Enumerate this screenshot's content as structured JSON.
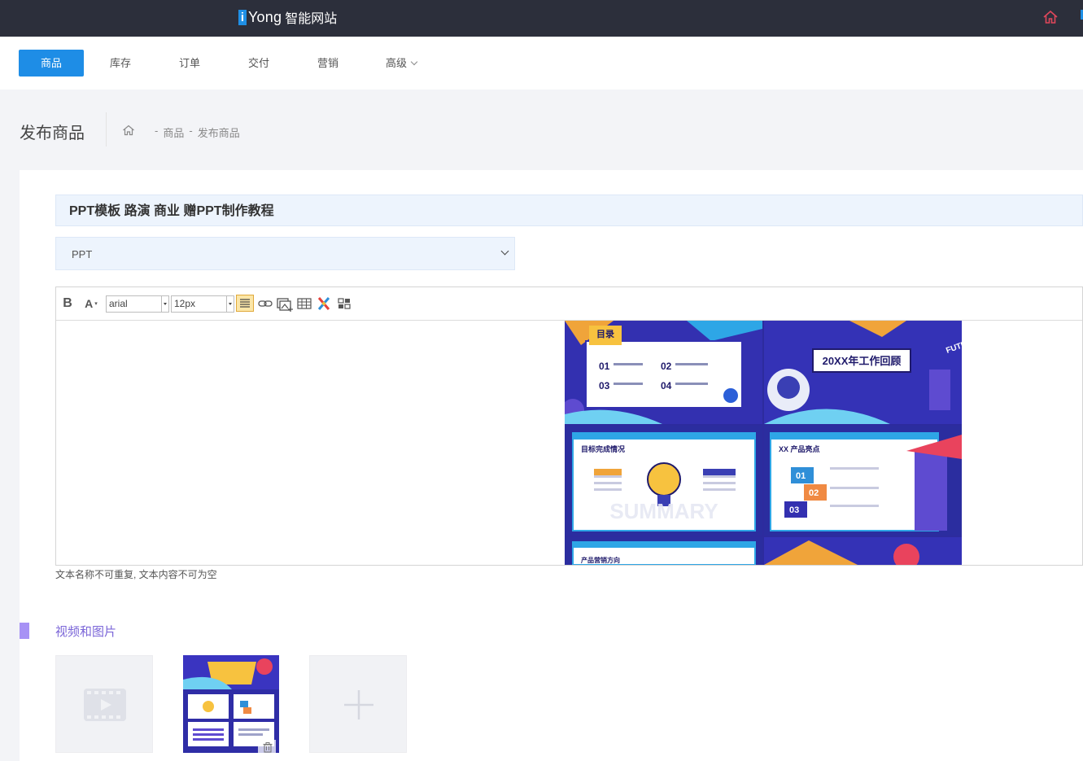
{
  "topbar": {
    "logo_mark": "i",
    "logo_brand": "Yong",
    "logo_sub": "智能网站"
  },
  "nav": {
    "items": [
      {
        "label": "商品"
      },
      {
        "label": "库存"
      },
      {
        "label": "订单"
      },
      {
        "label": "交付"
      },
      {
        "label": "营销"
      },
      {
        "label": "高级"
      }
    ]
  },
  "header": {
    "title": "发布商品",
    "breadcrumb": [
      "-",
      "商品",
      "-",
      "发布商品"
    ]
  },
  "form": {
    "product_title": "PPT模板 路演 商业 赠PPT制作教程",
    "category_value": "PPT",
    "editor": {
      "font_family": "arial",
      "font_size": "12px"
    },
    "hint": "文本名称不可重复, 文本内容不可为空"
  },
  "media": {
    "section_title": "视频和图片"
  },
  "slide": {
    "s1_title": "目录",
    "s1_items": [
      "01",
      "02",
      "03",
      "04"
    ],
    "s2_title": "20XX年工作回顾",
    "s3_title": "目标完成情况",
    "s4_title": "XX 产品亮点",
    "s4_items": [
      "01",
      "02",
      "03"
    ],
    "s5_title": "产品营销方向",
    "watermark": "SUMMARY",
    "sign": "FUTURE"
  },
  "colors": {
    "topbar": "#2c2f3b",
    "accent": "#1e8de6",
    "section": "#a792f5"
  }
}
